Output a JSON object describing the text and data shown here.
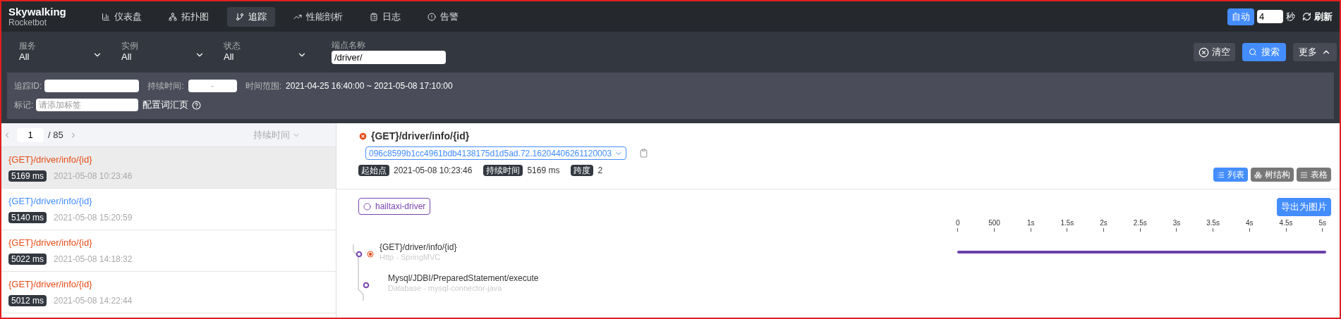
{
  "logo": {
    "name": "Skywalking",
    "sub": "Rocketbot"
  },
  "nav": [
    {
      "label": "仪表盘",
      "selected": false
    },
    {
      "label": "拓扑图",
      "selected": false
    },
    {
      "label": "追踪",
      "selected": true
    },
    {
      "label": "性能剖析",
      "selected": false
    },
    {
      "label": "日志",
      "selected": false
    },
    {
      "label": "告警",
      "selected": false
    }
  ],
  "refresh": {
    "auto_button": "自动",
    "interval": "4",
    "unit": "秒",
    "refresh_label": "刷新"
  },
  "filters": [
    {
      "label": "服务",
      "value": "All"
    },
    {
      "label": "实例",
      "value": "All"
    },
    {
      "label": "状态",
      "value": "All"
    }
  ],
  "endpoint": {
    "label": "端点名称",
    "value": "/driver/"
  },
  "actions": {
    "clear": "清空",
    "search": "搜索",
    "more": "更多"
  },
  "more_panel": {
    "trace_id_label": "追踪ID:",
    "duration_label": "持续时间:",
    "duration_sep": "-",
    "time_range_label": "时间范围:",
    "time_range": "2021-04-25 16:40:00 ~ 2021-05-08 17:10:00",
    "tag_label": "标记:",
    "tag_placeholder": "请添加标签",
    "vocab_link": "配置词汇页"
  },
  "pager": {
    "page": "1",
    "total": "/ 85",
    "sort": "持续时间"
  },
  "traces": [
    {
      "title": "{GET}/driver/info/{id}",
      "duration": "5169 ms",
      "time": "2021-05-08 10:23:46",
      "error": true,
      "selected": true
    },
    {
      "title": "{GET}/driver/info/{id}",
      "duration": "5140 ms",
      "time": "2021-05-08 15:20:59",
      "error": false,
      "selected": false
    },
    {
      "title": "{GET}/driver/info/{id}",
      "duration": "5022 ms",
      "time": "2021-05-08 14:18:32",
      "error": true,
      "selected": false
    },
    {
      "title": "{GET}/driver/info/{id}",
      "duration": "5012 ms",
      "time": "2021-05-08 14:22:44",
      "error": true,
      "selected": false
    }
  ],
  "detail": {
    "title": "{GET}/driver/info/{id}",
    "error": true,
    "trace_id": "096c8599b1cc4961bdb4138175d1d5ad.72.16204406261120003",
    "meta": [
      {
        "label": "起始点",
        "value": "2021-05-08 10:23:46"
      },
      {
        "label": "持续时间",
        "value": "5169 ms"
      },
      {
        "label": "跨度",
        "value": "2"
      }
    ],
    "views": [
      {
        "label": "列表",
        "selected": true
      },
      {
        "label": "树结构",
        "selected": false
      },
      {
        "label": "表格",
        "selected": false
      }
    ],
    "service": "hailtaxi-driver",
    "export": "导出为图片",
    "ticks": [
      "0",
      "500",
      "1s",
      "1.5s",
      "2s",
      "2.5s",
      "3s",
      "3.5s",
      "4s",
      "4.5s",
      "5s"
    ],
    "spans": [
      {
        "name": "{GET}/driver/info/{id}",
        "type": "Http - SpringMVC",
        "error": true,
        "level": 0.95
      },
      {
        "name": "Mysql/JDBI/PreparedStatement/execute",
        "type": "Database - mysql-connector-java",
        "error": false
      }
    ]
  }
}
